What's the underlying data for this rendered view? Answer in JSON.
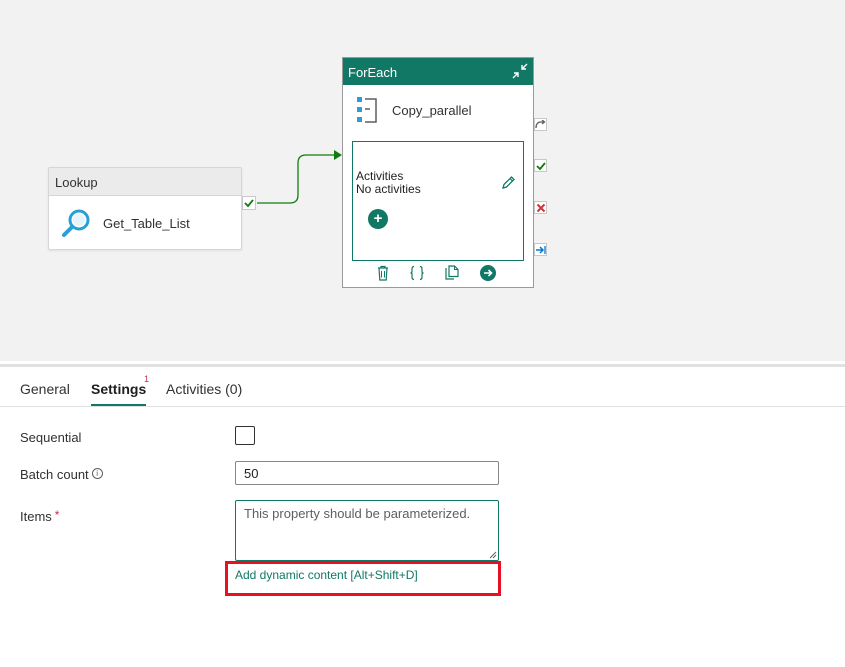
{
  "canvas": {
    "lookup": {
      "type_label": "Lookup",
      "name": "Get_Table_List",
      "icon": "magnifier-icon"
    },
    "foreach": {
      "type_label": "ForEach",
      "child_name": "Copy_parallel",
      "child_icon": "copy-activity-icon",
      "inner": {
        "title": "Activities",
        "subtitle": "No activities",
        "add_symbol": "+"
      },
      "footer_icons": [
        "delete-icon",
        "code-braces-icon",
        "copy-icon",
        "go-arrow-icon"
      ]
    },
    "colors": {
      "brand": "#117865",
      "success": "#107c10",
      "failure": "#d13438",
      "completion": "#0078d4",
      "highlight": "#e81123"
    }
  },
  "properties": {
    "tabs": [
      {
        "label": "General",
        "active": false
      },
      {
        "label": "Settings",
        "active": true,
        "badge": "1"
      },
      {
        "label": "Activities (0)",
        "active": false
      }
    ],
    "fields": {
      "sequential": {
        "label": "Sequential",
        "checked": false
      },
      "batch_count": {
        "label": "Batch count",
        "info_symbol": "i",
        "value": "50"
      },
      "items": {
        "label": "Items",
        "required_mark": "*",
        "placeholder": "This property should be parameterized.",
        "value": ""
      }
    },
    "dynamic_content_link": "Add dynamic content [Alt+Shift+D]"
  }
}
